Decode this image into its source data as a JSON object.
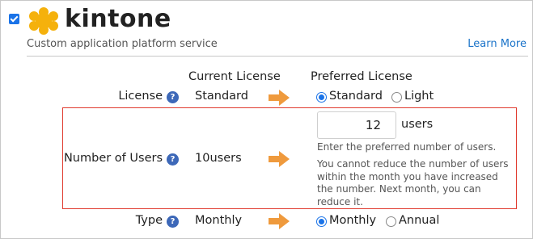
{
  "header": {
    "app_name": "kintone",
    "subtitle": "Custom application platform service",
    "learn_more": "Learn More",
    "checked": true,
    "logo_color": "#f5b10c"
  },
  "columns": {
    "current": "Current License",
    "preferred": "Preferred License"
  },
  "rows": {
    "license": {
      "label": "License",
      "current": "Standard",
      "options": [
        "Standard",
        "Light"
      ],
      "selected": "Standard"
    },
    "users": {
      "label": "Number of Users",
      "current": "10users",
      "input_value": "12",
      "unit": "users",
      "hint": "Enter the preferred number of users.",
      "notice": "You cannot reduce the number of users within the month you have increased the number. Next month, you can reduce it."
    },
    "type": {
      "label": "Type",
      "current": "Monthly",
      "options": [
        "Monthly",
        "Annual"
      ],
      "selected": "Monthly"
    }
  },
  "help_glyph": "?",
  "colors": {
    "accent": "#1a73e8",
    "link": "#1a73c9",
    "help": "#3d68b8",
    "arrow": "#ef9a3d",
    "highlight": "#e03a2e"
  }
}
